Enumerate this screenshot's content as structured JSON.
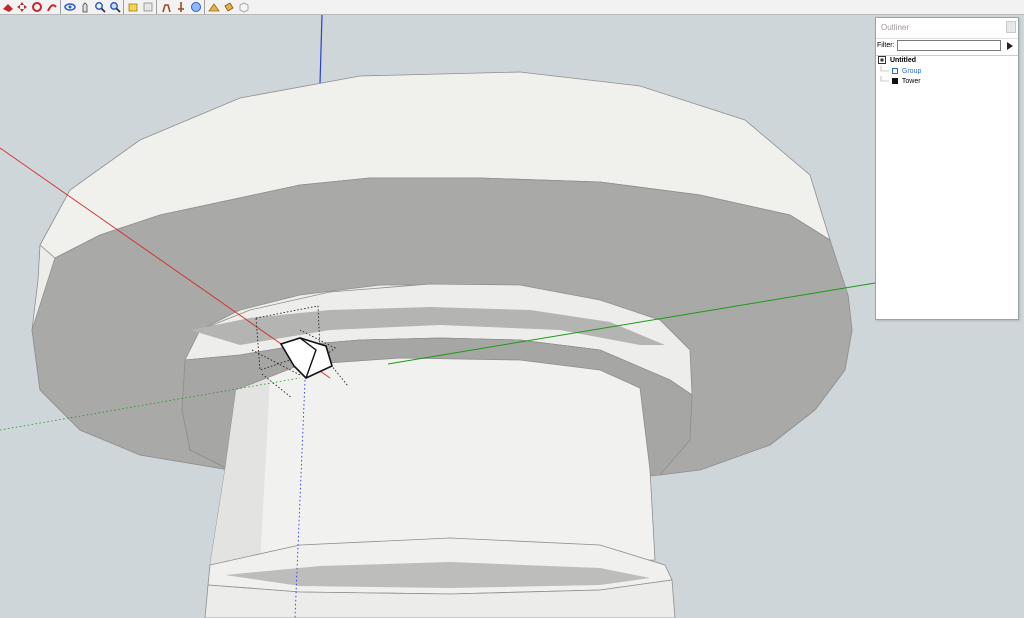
{
  "toolbar": {
    "tools": [
      {
        "icon": "eraser-icon",
        "color": "#c0282c"
      },
      {
        "icon": "move-icon",
        "color": "#c0282c"
      },
      {
        "icon": "rotate-icon",
        "color": "#c0282c"
      },
      {
        "icon": "follow-me-icon",
        "color": "#c0282c"
      },
      {
        "icon": "orbit-icon",
        "color": "#2a5cc6"
      },
      {
        "icon": "pan-icon",
        "color": "#444444"
      },
      {
        "icon": "zoom-icon",
        "color": "#2a5cc6"
      },
      {
        "icon": "zoom-window-icon",
        "color": "#2a5cc6"
      },
      {
        "icon": "section-plane-icon",
        "color": "#e0b020"
      },
      {
        "icon": "dimension-icon",
        "color": "#888888"
      },
      {
        "icon": "walk-icon",
        "color": "#a04a20"
      },
      {
        "icon": "position-camera-icon",
        "color": "#a04a20"
      },
      {
        "icon": "look-around-icon",
        "color": "#2a5cc6"
      },
      {
        "icon": "sandbox-icon",
        "color": "#c08020"
      },
      {
        "icon": "paint-bucket-icon",
        "color": "#c08020"
      },
      {
        "icon": "components-icon",
        "color": "#999999"
      }
    ]
  },
  "outliner": {
    "title": "Outliner",
    "filter_label": "Filter:",
    "filter_value": "",
    "tree": [
      {
        "label": "Untitled",
        "icon": "model-icon",
        "bold": true,
        "color": "#000000"
      },
      {
        "label": "Group",
        "icon": "group-icon",
        "bold": false,
        "color": "#2a6fd6"
      },
      {
        "label": "Tower",
        "icon": "component-icon",
        "bold": false,
        "color": "#000000"
      }
    ]
  },
  "colors": {
    "sky": "#cfd6da",
    "axis_red": "#d62a2a",
    "axis_green": "#1a9a1a",
    "axis_blue": "#2a3fd6"
  }
}
